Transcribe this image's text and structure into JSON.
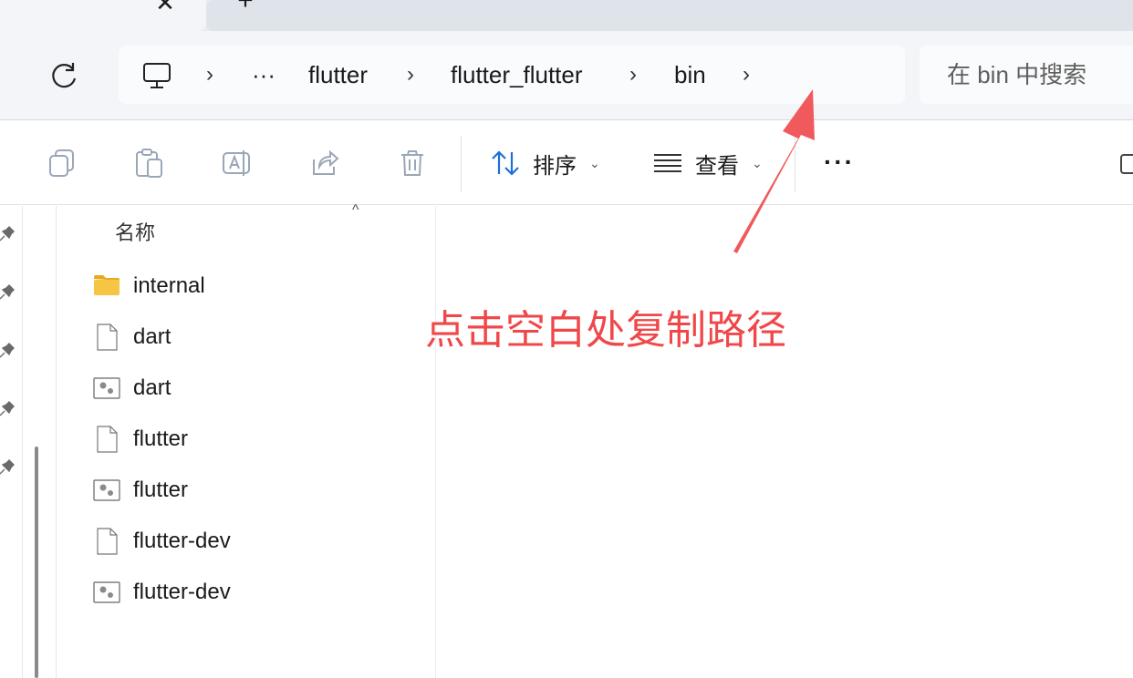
{
  "tabs": {
    "close_glyph": "✕",
    "new_tab_glyph": "+"
  },
  "address": {
    "overflow": "···",
    "crumbs": [
      "flutter",
      "flutter_flutter",
      "bin"
    ],
    "separator": "›"
  },
  "search": {
    "placeholder": "在 bin 中搜索"
  },
  "toolbar": {
    "sort_label": "排序",
    "view_label": "查看",
    "caret": "⌄",
    "more": "···"
  },
  "filelist": {
    "column_name": "名称",
    "sort_caret": "^",
    "items": [
      {
        "name": "internal",
        "icon": "folder-icon"
      },
      {
        "name": "dart",
        "icon": "file-icon"
      },
      {
        "name": "dart",
        "icon": "batch-file-icon"
      },
      {
        "name": "flutter",
        "icon": "file-icon"
      },
      {
        "name": "flutter",
        "icon": "batch-file-icon"
      },
      {
        "name": "flutter-dev",
        "icon": "file-icon"
      },
      {
        "name": "flutter-dev",
        "icon": "batch-file-icon"
      }
    ]
  },
  "annotation": {
    "text": "点击空白处复制路径",
    "color": "#f0474a"
  },
  "colors": {
    "accent_blue": "#1e6fd9",
    "folder_yellow": "#f6c544"
  }
}
